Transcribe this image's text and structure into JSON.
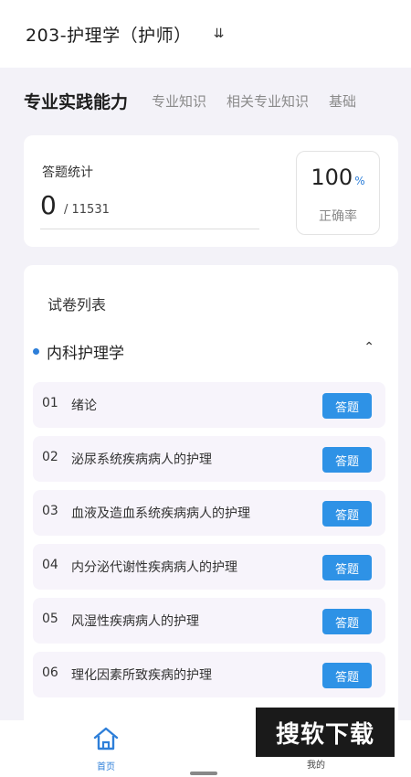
{
  "header": {
    "title": "203-护理学（护师）",
    "chevron_icon": "double-chevron-down-icon"
  },
  "tabs": [
    {
      "label": "专业实践能力",
      "active": true
    },
    {
      "label": "专业知识",
      "active": false
    },
    {
      "label": "相关专业知识",
      "active": false
    },
    {
      "label": "基础",
      "active": false
    }
  ],
  "stats": {
    "label": "答题统计",
    "answered": "0",
    "total": "/ 11531",
    "accuracy_value": "100",
    "accuracy_unit": "%",
    "accuracy_label": "正确率"
  },
  "paper_list": {
    "title": "试卷列表",
    "section": {
      "name": "内科护理学",
      "collapse_icon": "chevron-up-icon"
    },
    "items": [
      {
        "index": "01",
        "title": "绪论",
        "button": "答题"
      },
      {
        "index": "02",
        "title": "泌尿系统疾病病人的护理",
        "button": "答题"
      },
      {
        "index": "03",
        "title": "血液及造血系统疾病病人的护理",
        "button": "答题"
      },
      {
        "index": "04",
        "title": "内分泌代谢性疾病病人的护理",
        "button": "答题"
      },
      {
        "index": "05",
        "title": "风湿性疾病病人的护理",
        "button": "答题"
      },
      {
        "index": "06",
        "title": "理化因素所致疾病的护理",
        "button": "答题"
      }
    ]
  },
  "nav": {
    "home_label": "首页",
    "home_icon": "home-icon",
    "mine_label": "我的"
  },
  "watermark": "搜软下载",
  "colors": {
    "accent": "#2e7fd9",
    "button": "#2e92e6",
    "background": "#f3f2f8"
  }
}
